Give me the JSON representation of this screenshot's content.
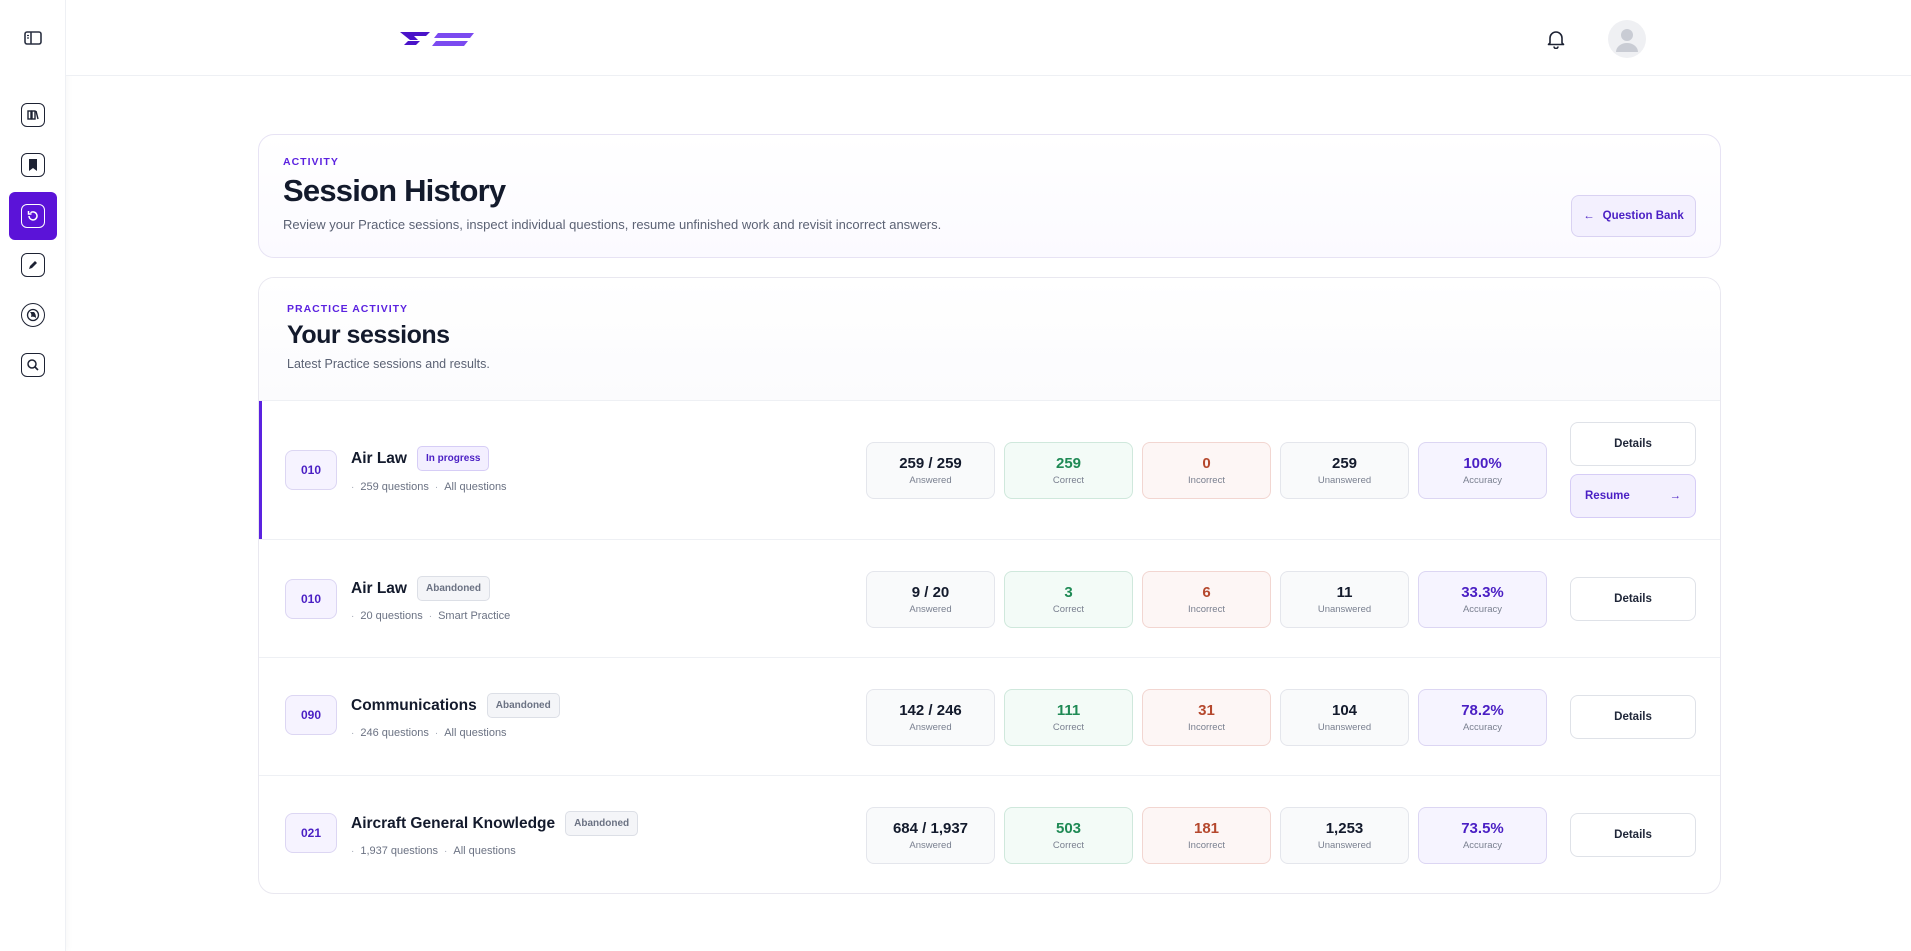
{
  "sidebar": {
    "items": [
      {
        "name": "library-icon",
        "active": false
      },
      {
        "name": "bookmark-icon",
        "active": false
      },
      {
        "name": "history-icon",
        "active": true
      },
      {
        "name": "pencil-icon",
        "active": false
      },
      {
        "name": "globe-icon",
        "active": false
      },
      {
        "name": "search-icon",
        "active": false
      }
    ]
  },
  "colors": {
    "accent": "#5b13d8",
    "correct": "#1f8a55",
    "incorrect": "#b5482d",
    "accuracy": "#4a1fc4"
  },
  "hero": {
    "eyebrow": "ACTIVITY",
    "title": "Session History",
    "description": "Review your Practice sessions, inspect individual questions, resume unfinished work and revisit incorrect answers.",
    "back_button": "Question Bank",
    "back_arrow": "←"
  },
  "sessions": {
    "eyebrow": "PRACTICE ACTIVITY",
    "title": "Your sessions",
    "subtitle": "Latest Practice sessions and results.",
    "stat_labels": {
      "answered": "Answered",
      "correct": "Correct",
      "incorrect": "Incorrect",
      "unanswered": "Unanswered",
      "accuracy": "Accuracy"
    },
    "details_label": "Details",
    "resume_label": "Resume",
    "resume_arrow": "→",
    "rows": [
      {
        "code": "010",
        "title": "Air Law",
        "badge": "In progress",
        "questions": "259 questions",
        "mode": "All questions",
        "answered": "259 / 259",
        "correct": "259",
        "incorrect": "0",
        "unanswered": "259",
        "accuracy": "100%"
      },
      {
        "code": "010",
        "title": "Air Law",
        "badge": "Abandoned",
        "questions": "20 questions",
        "mode": "Smart Practice",
        "answered": "9 / 20",
        "correct": "3",
        "incorrect": "6",
        "unanswered": "11",
        "accuracy": "33.3%"
      },
      {
        "code": "090",
        "title": "Communications",
        "badge": "Abandoned",
        "questions": "246 questions",
        "mode": "All questions",
        "answered": "142 / 246",
        "correct": "111",
        "incorrect": "31",
        "unanswered": "104",
        "accuracy": "78.2%"
      },
      {
        "code": "021",
        "title": "Aircraft General Knowledge",
        "badge": "Abandoned",
        "questions": "1,937 questions",
        "mode": "All questions",
        "answered": "684 / 1,937",
        "correct": "503",
        "incorrect": "181",
        "unanswered": "1,253",
        "accuracy": "73.5%"
      }
    ]
  }
}
